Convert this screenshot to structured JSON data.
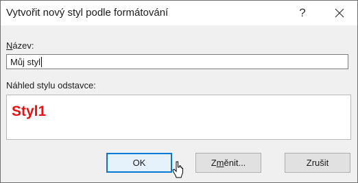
{
  "dialog": {
    "title": "Vytvořit nový styl podle formátování",
    "help_glyph": "?",
    "close_icon": "close-icon"
  },
  "name_field": {
    "label_accel": "N",
    "label_rest": "ázev:",
    "value": "Můj styl"
  },
  "preview": {
    "label": "Náhled stylu odstavce:",
    "sample_text": "Styl1",
    "sample_color": "#e81010"
  },
  "buttons": {
    "ok_label": "OK",
    "modify_pre": "Z",
    "modify_accel": "m",
    "modify_post": "ěnit...",
    "cancel_label": "Zrušit"
  },
  "accent_color": "#0078d7"
}
